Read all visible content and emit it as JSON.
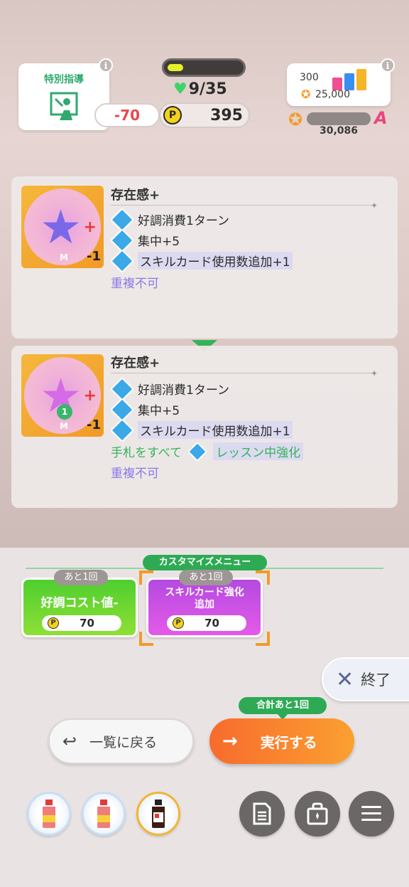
{
  "hud": {
    "special_label": "特別指導",
    "hp": "9/35",
    "penalty": "-70",
    "points": "395",
    "p_coin": "P",
    "stat_top": "300",
    "stat_bottom": "25,000",
    "rank_points": "30,086",
    "rank_letter": "A",
    "info_glyph": "i",
    "stamina_fraction": 0.22
  },
  "panels": [
    {
      "title": "存在感+",
      "cost": "-1",
      "effects": [
        "好調消費1ターン",
        "集中+5",
        "スキルカード使用数追加+1"
      ],
      "note": "重複不可"
    },
    {
      "title": "存在感+",
      "cost": "-1",
      "level": "1",
      "effects": [
        "好調消費1ターン",
        "集中+5",
        "スキルカード使用数追加+1"
      ],
      "extra_prefix": "手札をすべて",
      "extra_suffix": "レッスン中強化",
      "note": "重複不可"
    }
  ],
  "customize": {
    "menu_label": "カスタマイズメニュー",
    "cards": [
      {
        "remain": "あと1回",
        "title": "好調コスト値-",
        "cost": "70"
      },
      {
        "remain": "あと1回",
        "title": "スキルカード強化追加",
        "cost": "70"
      }
    ]
  },
  "buttons": {
    "end": "終了",
    "back": "一覧に戻る",
    "execute": "実行する",
    "total_remain": "合計あと1回"
  },
  "icons": {
    "end": "close-icon",
    "back": "return-arrow-icon",
    "execute": "arrow-right-icon",
    "toolbar": [
      "document-icon",
      "bag-icon",
      "menu-icon"
    ]
  },
  "colors": {
    "accent_green": "#2eaa55",
    "accent_orange": "#f86b2d",
    "card_green": "#4fce2f",
    "card_purple": "#c84ae2",
    "penalty_red": "#e9474c"
  }
}
